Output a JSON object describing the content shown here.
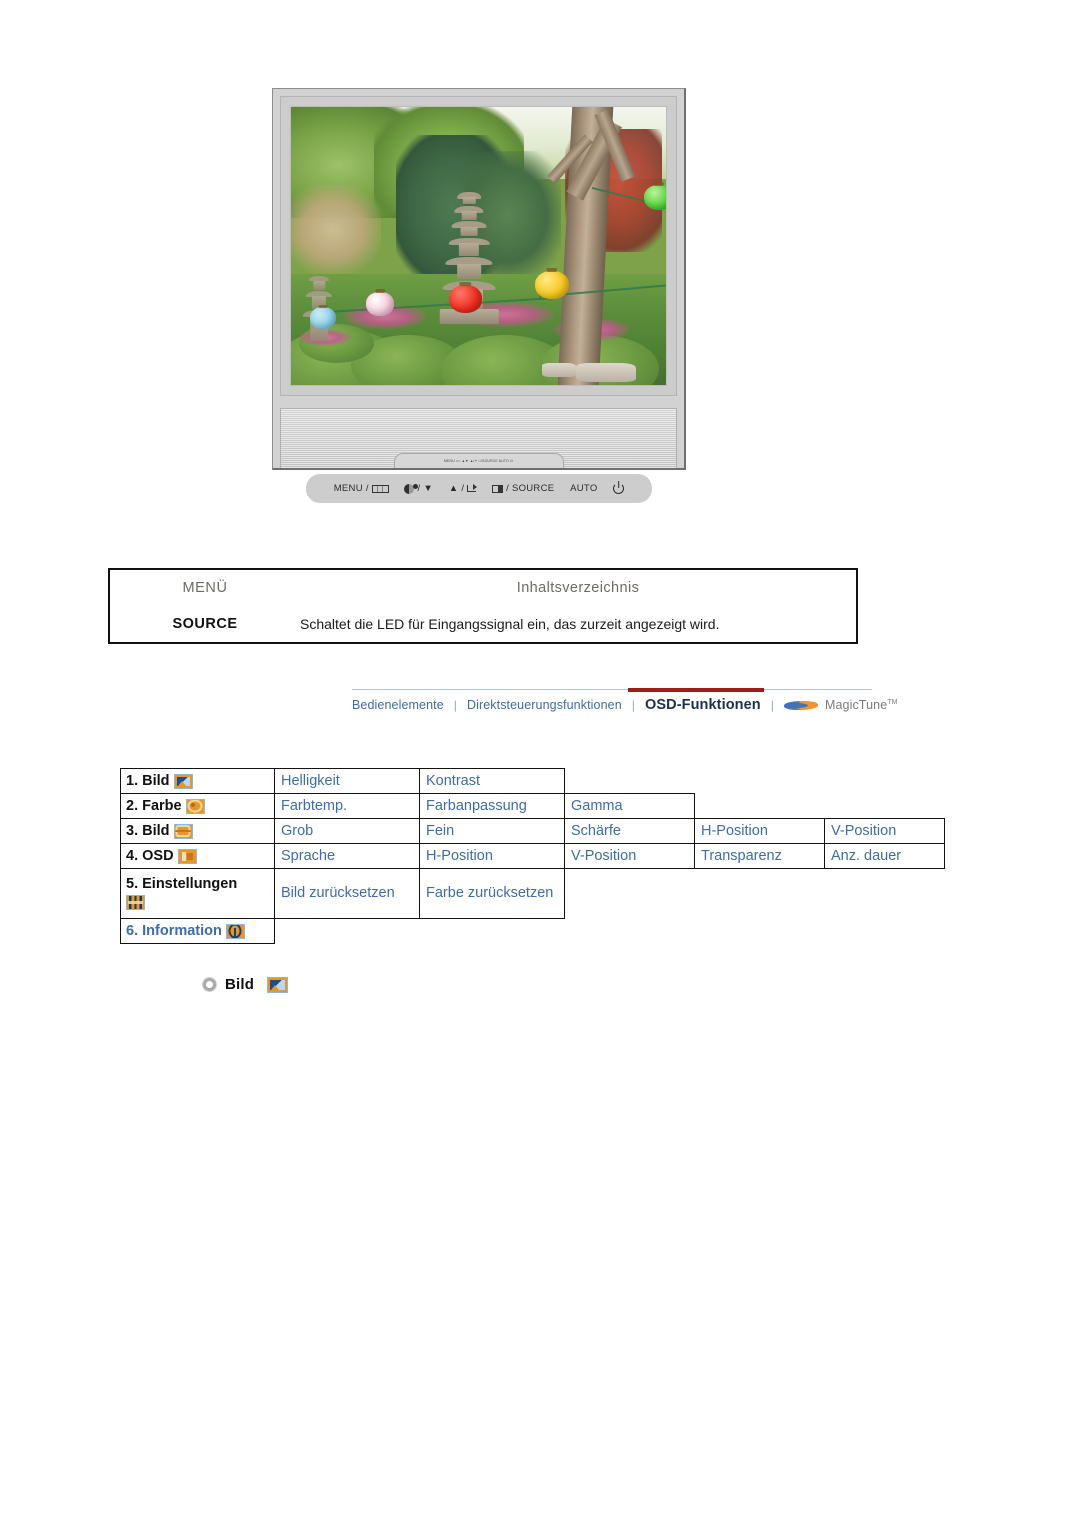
{
  "monitor": {
    "alt": "LCD-Monitor mit Gartenfoto auf dem Bildschirm",
    "controls": [
      {
        "label": "MENU /",
        "icon": "menu-icon"
      },
      {
        "label": "/ ▼",
        "icon": "brightness-icon"
      },
      {
        "label": "▲ /",
        "icon": "enter-icon"
      },
      {
        "label": "/ SOURCE",
        "icon": "source-icon"
      },
      {
        "label": "AUTO",
        "icon": ""
      },
      {
        "label": "",
        "icon": "power-icon"
      }
    ],
    "base_strip_text": "MENU □□  ▲▼ ▲/↵  □/SOURCE  AUTO  ⏻"
  },
  "source_table": {
    "header": {
      "menu": "MENÜ",
      "toc": "Inhaltsverzeichnis"
    },
    "rows": [
      {
        "key": "SOURCE",
        "value": "Schaltet die LED für Eingangssignal ein, das zurzeit angezeigt wird."
      }
    ]
  },
  "nav": {
    "items": [
      {
        "label": "Bedienelemente",
        "active": false
      },
      {
        "label": "Direktsteuerungsfunktionen",
        "active": false
      },
      {
        "label": "OSD-Funktionen",
        "active": true
      }
    ],
    "separator": "❘",
    "magictune": {
      "label": "MagicTune",
      "tm": "TM",
      "logo": "magictune-logo"
    },
    "accent_color": "#9e1b1b",
    "link_color": "#3e6ca8"
  },
  "osd_menu": {
    "rows": [
      {
        "category": "1. Bild",
        "icon": "picture-icon",
        "category_is_link": false,
        "items": [
          "Helligkeit",
          "Kontrast"
        ]
      },
      {
        "category": "2. Farbe",
        "icon": "color-icon",
        "category_is_link": false,
        "items": [
          "Farbtemp.",
          "Farbanpassung",
          "Gamma"
        ]
      },
      {
        "category": "3. Bild",
        "icon": "geometry-icon",
        "category_is_link": false,
        "items": [
          "Grob",
          "Fein",
          "Schärfe",
          "H-Position",
          "V-Position"
        ]
      },
      {
        "category": "4. OSD",
        "icon": "osd-window-icon",
        "category_is_link": false,
        "items": [
          "Sprache",
          "H-Position",
          "V-Position",
          "Transparenz",
          "Anz. dauer"
        ]
      },
      {
        "category": "5. Einstellungen",
        "icon": "settings-icon",
        "category_is_link": false,
        "items": [
          "Bild zurücksetzen",
          "Farbe zurücksetzen"
        ]
      },
      {
        "category": "6. Information",
        "icon": "information-icon",
        "category_is_link": true,
        "items": []
      }
    ]
  },
  "section": {
    "bullet": "ring-bullet-icon",
    "title": "Bild",
    "icon": "picture-icon"
  }
}
